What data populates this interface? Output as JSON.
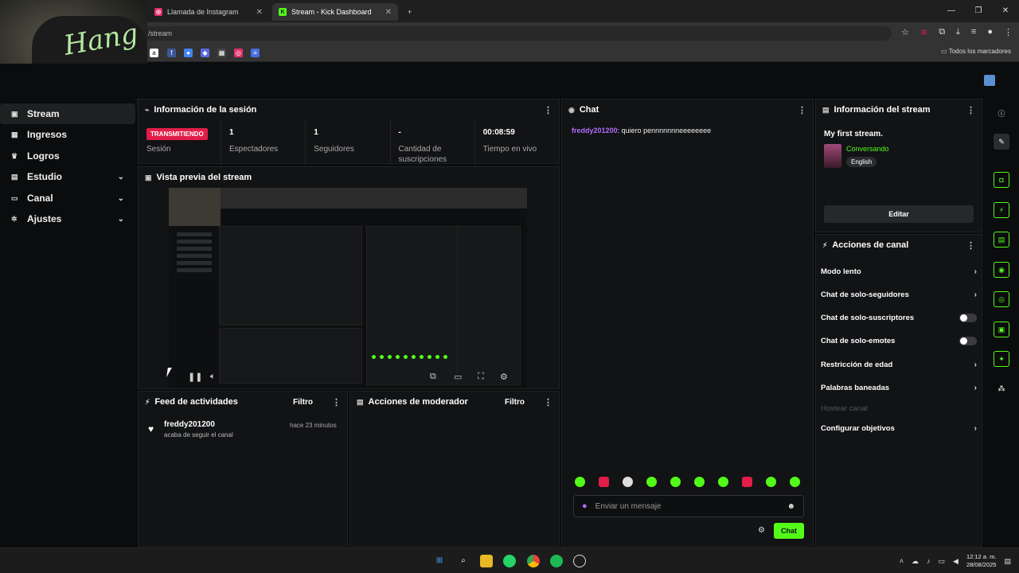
{
  "browser": {
    "tabs": [
      {
        "label": "Llamada de Instagram"
      },
      {
        "label": "Stream - Kick Dashboard"
      }
    ],
    "url": "/stream",
    "bookmarks_all": "Todos los marcadores"
  },
  "nav": {
    "items": [
      {
        "label": "Stream",
        "icon": "stream-icon"
      },
      {
        "label": "Ingresos",
        "icon": "grid-icon"
      },
      {
        "label": "Logros",
        "icon": "trophy-icon"
      },
      {
        "label": "Estudio",
        "icon": "studio-icon"
      },
      {
        "label": "Canal",
        "icon": "channel-icon"
      },
      {
        "label": "Ajustes",
        "icon": "gear-icon"
      }
    ]
  },
  "session": {
    "title": "Información de la sesión",
    "status_badge": "TRANSMITIENDO",
    "status_label": "Sesión",
    "stats": [
      {
        "value": "1",
        "label": "Espectadores"
      },
      {
        "value": "1",
        "label": "Seguidores"
      },
      {
        "value": "-",
        "label": "Cantidad de suscripciones"
      },
      {
        "value": "00:08:59",
        "label": "Tiempo en vivo"
      }
    ]
  },
  "preview": {
    "title": "Vista previa del stream"
  },
  "feed": {
    "title": "Feed de actividades",
    "filter": "Filtro",
    "items": [
      {
        "user": "freddy201200",
        "action": "acaba de seguir el canal",
        "time": "hace 23 minutos"
      }
    ]
  },
  "moderator": {
    "title": "Acciones de moderador",
    "filter": "Filtro"
  },
  "chat": {
    "title": "Chat",
    "messages": [
      {
        "user": "freddy201200",
        "text": ": quiero pennnnnnneeeeeeee"
      }
    ],
    "input_placeholder": "Enviar un mensaje",
    "send_label": "Chat",
    "accent": "#53fc18"
  },
  "stream_info": {
    "title": "Información del stream",
    "stream_title": "My first stream.",
    "category": "Conversando",
    "language": "English",
    "edit_label": "Editar"
  },
  "channel_actions": {
    "title": "Acciones de canal",
    "items": [
      {
        "label": "Modo lento",
        "control": "chevron"
      },
      {
        "label": "Chat de solo-seguidores",
        "control": "chevron"
      },
      {
        "label": "Chat de solo-suscriptores",
        "control": "toggle",
        "on": false
      },
      {
        "label": "Chat de solo-emotes",
        "control": "toggle",
        "on": false
      },
      {
        "label": "Restricción de edad",
        "control": "chevron"
      },
      {
        "label": "Palabras baneadas",
        "control": "chevron"
      },
      {
        "label": "Hostear canal",
        "control": "disabled"
      },
      {
        "label": "Configurar objetivos",
        "control": "chevron"
      }
    ]
  },
  "taskbar": {
    "time": "12:12 a. m.",
    "date": "28/08/2025"
  }
}
